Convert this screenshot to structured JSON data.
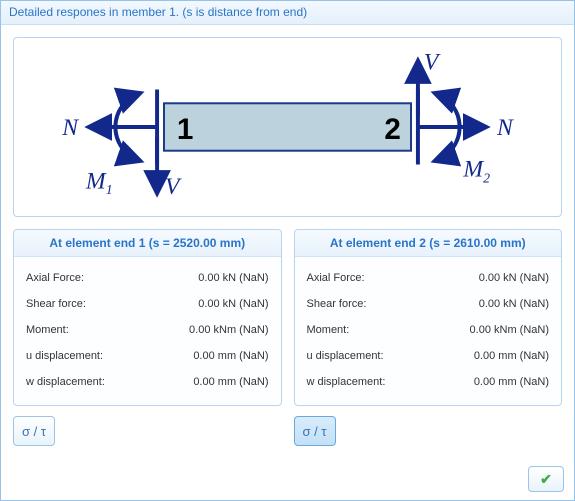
{
  "window_title": "Detailed respones in member 1. (s is distance from end)",
  "diagram": {
    "labels": {
      "N_left": "N",
      "N_right": "N",
      "V_left": "V",
      "V_right": "V",
      "M1": "M",
      "M1_sub": "1",
      "M2": "M",
      "M2_sub": "2",
      "node1": "1",
      "node2": "2"
    }
  },
  "panels": {
    "end1": {
      "title": "At element end 1 (s = 2520.00 mm)",
      "rows": {
        "axial": {
          "label": "Axial Force:",
          "value": "0.00 kN  (NaN)"
        },
        "shear": {
          "label": "Shear force:",
          "value": "0.00 kN  (NaN)"
        },
        "moment": {
          "label": "Moment:",
          "value": "0.00 kNm  (NaN)"
        },
        "udisp": {
          "label": "u displacement:",
          "value": "0.00 mm  (NaN)"
        },
        "wdisp": {
          "label": "w displacement:",
          "value": "0.00 mm  (NaN)"
        }
      }
    },
    "end2": {
      "title": "At element end 2 (s = 2610.00 mm)",
      "rows": {
        "axial": {
          "label": "Axial Force:",
          "value": "0.00 kN  (NaN)"
        },
        "shear": {
          "label": "Shear force:",
          "value": "0.00 kN  (NaN)"
        },
        "moment": {
          "label": "Moment:",
          "value": "0.00 kNm  (NaN)"
        },
        "udisp": {
          "label": "u displacement:",
          "value": "0.00 mm  (NaN)"
        },
        "wdisp": {
          "label": "w displacement:",
          "value": "0.00 mm  (NaN)"
        }
      }
    }
  },
  "buttons": {
    "sigma_tau": "σ / τ"
  },
  "colors": {
    "accent": "#2a74c7",
    "arrow": "#12298b",
    "beamFill": "#bcd3de",
    "beamStroke": "#1b3a8a"
  }
}
